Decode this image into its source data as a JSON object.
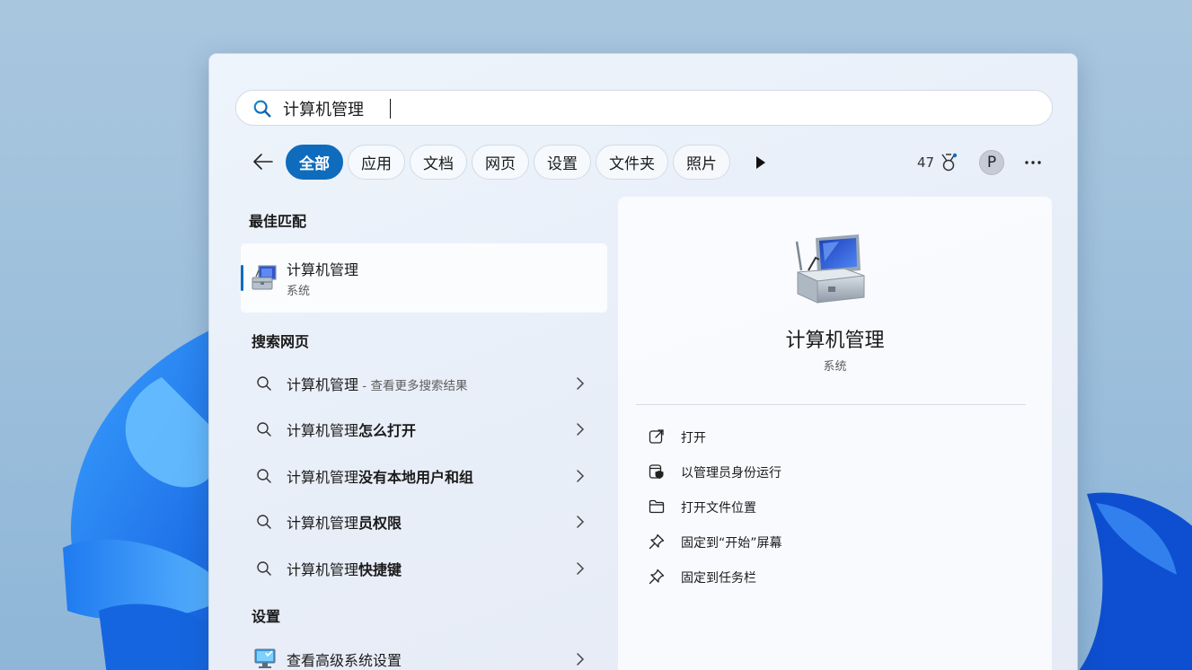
{
  "search": {
    "value": "计算机管理",
    "icon": "search-icon"
  },
  "filters": {
    "tabs": [
      "全部",
      "应用",
      "文档",
      "网页",
      "设置",
      "文件夹",
      "照片"
    ],
    "active": "全部",
    "points": "47",
    "avatar_letter": "P"
  },
  "best_match": {
    "heading": "最佳匹配",
    "title": "计算机管理",
    "subtitle": "系统"
  },
  "web_search": {
    "heading": "搜索网页",
    "items": [
      {
        "prefix": "计算机管理",
        "bold": "",
        "suffix": " - 查看更多搜索结果"
      },
      {
        "prefix": "计算机管理",
        "bold": "怎么打开",
        "suffix": ""
      },
      {
        "prefix": "计算机管理",
        "bold": "没有本地用户和组",
        "suffix": ""
      },
      {
        "prefix": "计算机管理",
        "bold": "员权限",
        "suffix": ""
      },
      {
        "prefix": "计算机管理",
        "bold": "快捷键",
        "suffix": ""
      }
    ]
  },
  "settings_section": {
    "heading": "设置",
    "item": "查看高级系统设置"
  },
  "detail": {
    "title": "计算机管理",
    "subtitle": "系统",
    "actions": [
      {
        "label": "打开",
        "icon": "open-external-icon"
      },
      {
        "label": "以管理员身份运行",
        "icon": "shield-run-icon"
      },
      {
        "label": "打开文件位置",
        "icon": "folder-icon"
      },
      {
        "label": "固定到“开始”屏幕",
        "icon": "pin-icon"
      },
      {
        "label": "固定到任务栏",
        "icon": "pin-icon"
      }
    ]
  },
  "colors": {
    "accent": "#0f6cbd",
    "panel_bg": "#eef4fb",
    "card_bg": "#ffffff"
  }
}
